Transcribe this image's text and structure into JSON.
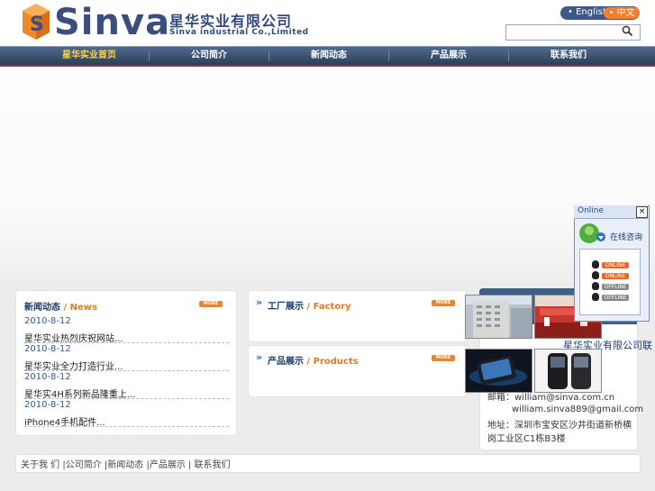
{
  "header": {
    "logo_text": "Sinva",
    "company_cn": "星华实业有限公司",
    "company_en": "Sinva industrial Co.,Limited",
    "lang_en": "• English",
    "lang_cn": "• 中文",
    "search_placeholder": ""
  },
  "nav": {
    "items": [
      "星华实业首页",
      "公司简介",
      "新闻动态",
      "产品展示",
      "联系我们"
    ]
  },
  "news": {
    "title_cn": "新闻动态",
    "title_en": "/ News",
    "more": "MORE",
    "items": [
      {
        "date": "2010-8-12",
        "title": "星华实业热烈庆祝网站..."
      },
      {
        "date": "2010-8-12",
        "title": "星华实业全力打造行业..."
      },
      {
        "date": "2010-8-12",
        "title": "星华实4H系列新品隆重上..."
      },
      {
        "date": "2010-8-12",
        "title": "iPhone4手机配件..."
      }
    ]
  },
  "factory": {
    "title_cn": "工厂展示",
    "title_en": "/ Factory",
    "more": "MORE"
  },
  "products": {
    "title_cn": "产品展示",
    "title_en": "/ Products",
    "more": "MORE"
  },
  "contact": {
    "company": "星华实业有限公司联系方式",
    "email_line1": "邮箱：william@sinva.com.cn",
    "email_line2": "william.sinva889@gmail.com",
    "address": "地址：深圳市宝安区沙井街道新桥横岗工业区C1栋B3楼"
  },
  "online_widget": {
    "title": "Online",
    "close": "×",
    "consult": "在线咨询",
    "statuses": [
      "ONLINE",
      "ONLINE",
      "OFFLINE",
      "OFFLINE"
    ]
  },
  "footer": {
    "text": "关于我 们 |公司简介 |新闻动态 |产品展示 | 联系我们"
  },
  "colors": {
    "nav_active": "#ffd24a",
    "brand_blue": "#2e4a7d",
    "accent_orange": "#e8862f"
  }
}
